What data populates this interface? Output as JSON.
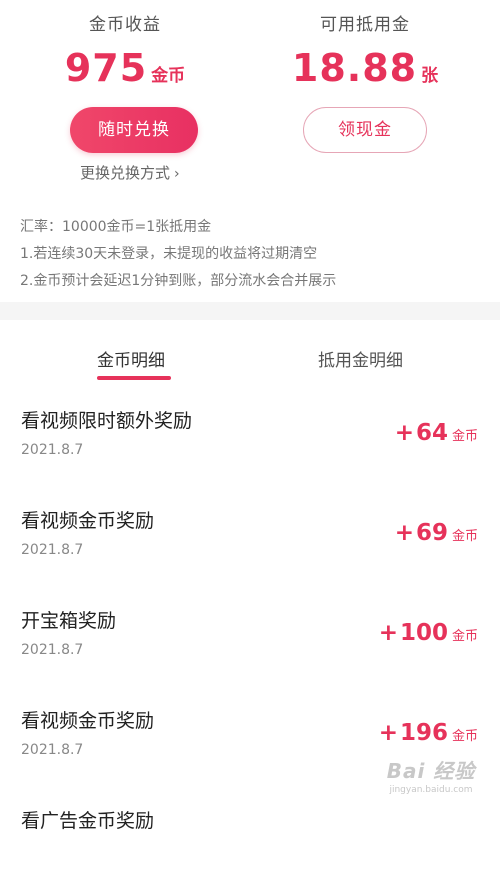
{
  "summary": {
    "coins": {
      "label": "金币收益",
      "value": "975",
      "unit": "金币",
      "button": "随时兑换"
    },
    "voucher": {
      "label": "可用抵用金",
      "value": "18.88",
      "unit": "张",
      "button": "领现金"
    },
    "change_method": "更换兑换方式",
    "change_chevron": "›"
  },
  "notes": [
    "汇率：10000金币=1张抵用金",
    "1.若连续30天未登录，未提现的收益将过期清空",
    "2.金币预计会延迟1分钟到账，部分流水会合并展示"
  ],
  "tabs": [
    {
      "label": "金币明细",
      "active": true
    },
    {
      "label": "抵用金明细",
      "active": false
    }
  ],
  "records": [
    {
      "title": "看视频限时额外奖励",
      "date": "2021.8.7",
      "sign": "+",
      "amount": "64",
      "unit": "金币"
    },
    {
      "title": "看视频金币奖励",
      "date": "2021.8.7",
      "sign": "+",
      "amount": "69",
      "unit": "金币"
    },
    {
      "title": "开宝箱奖励",
      "date": "2021.8.7",
      "sign": "+",
      "amount": "100",
      "unit": "金币"
    },
    {
      "title": "看视频金币奖励",
      "date": "2021.8.7",
      "sign": "+",
      "amount": "196",
      "unit": "金币"
    },
    {
      "title": "看广告金币奖励",
      "date": "",
      "sign": "",
      "amount": "",
      "unit": ""
    }
  ],
  "watermark": {
    "main": "Bai 经验",
    "sub": "jingyan.baidu.com"
  },
  "colors": {
    "accent": "#e6325a",
    "gap": "#f5f5f5"
  }
}
